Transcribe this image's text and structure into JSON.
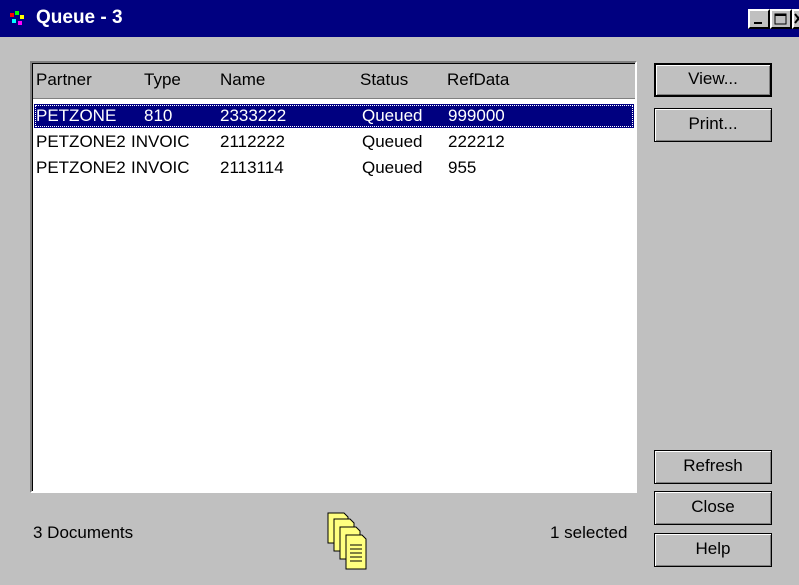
{
  "window": {
    "title": "Queue - 3",
    "icon": "app-icon"
  },
  "titlebar_buttons": [
    "minimize-icon",
    "maximize-icon",
    "close-icon"
  ],
  "list": {
    "columns": [
      "Partner",
      "Type",
      "Name",
      "Status",
      "RefData"
    ],
    "rows": [
      {
        "partner": "PETZONE",
        "type": "810",
        "name": "2333222",
        "status": "Queued",
        "refdata": "999000",
        "selected": true
      },
      {
        "partner": "PETZONE2",
        "type": "INVOIC",
        "name": "2112222",
        "status": "Queued",
        "refdata": "222212",
        "selected": false
      },
      {
        "partner": "PETZONE2",
        "type": "INVOIC",
        "name": "2113114",
        "status": "Queued",
        "refdata": "955",
        "selected": false
      }
    ]
  },
  "buttons": {
    "view": "View...",
    "print": "Print...",
    "refresh": "Refresh",
    "close": "Close",
    "help": "Help"
  },
  "status": {
    "count": "3 Documents",
    "selected": "1 selected",
    "icon": "documents-icon"
  },
  "colors": {
    "selection": "#000080",
    "titlebar": "#000080",
    "face": "#c0c0c0"
  }
}
